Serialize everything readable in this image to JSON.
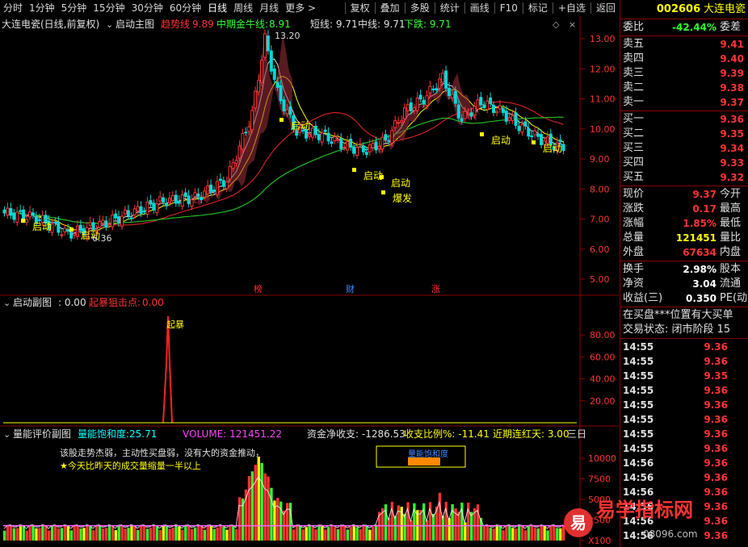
{
  "toolbar": {
    "left": [
      "分时",
      "1分钟",
      "5分钟",
      "15分钟",
      "30分钟",
      "60分钟",
      "日线",
      "周线",
      "月线",
      "更多 >"
    ],
    "right": [
      "复权",
      "叠加",
      "多股",
      "统计",
      "画线",
      "F10",
      "标记",
      "+自选",
      "返回"
    ],
    "active": "日线"
  },
  "main_panel": {
    "title": "大连电瓷(日线,前复权)",
    "indicator": "启动主图",
    "trend_label": "趋势线",
    "trend_value": "9.89",
    "mid_label": "中期金牛线:",
    "mid_value": "8.91",
    "short": "短线: 9.71",
    "mid_line": "中线: 9.71",
    "fall": "下跌: 9.71",
    "y_ticks": [
      "13.00",
      "12.00",
      "11.00",
      "10.00",
      "9.00",
      "8.00",
      "7.00",
      "6.00",
      "5.00"
    ],
    "high_label": "13.20",
    "low_label": "6.36",
    "markers": [
      "启动",
      "启动",
      "启动",
      "启动",
      "启动",
      "爆发",
      "启动",
      "启动"
    ],
    "bottom_marks": [
      "榜",
      "财",
      "涨"
    ]
  },
  "sub_panel": {
    "name": "启动副图",
    "value": ": 0.00",
    "label2": "起暴狙击点:",
    "value2": "0.00",
    "y_ticks": [
      "80.00",
      "60.00",
      "40.00",
      "20.00"
    ],
    "spike_label": "起暴"
  },
  "vol_panel": {
    "name": "量能评价副图",
    "sat_label": "量能饱和度:",
    "sat_value": "25.71",
    "volume": "VOLUME: 121451.22",
    "flow": "资金净收支: -1286.53",
    "ratio": "收支比例%: -11.41",
    "streak": "近期连红天: 3.00",
    "extra": "三日",
    "comment1": "该股走势杰弱，主动性买盘弱，没有大的资金推动，",
    "comment2": "★今天比昨天的成交量缩量一半以上",
    "box_label": "量能饱和度",
    "y_ticks": [
      "10000",
      "7500",
      "5000",
      "2500",
      "X100"
    ]
  },
  "sidebar": {
    "code": "002606",
    "name": "大连电瓷",
    "weibi_label": "委比",
    "weibi_value": "-42.44%",
    "weicha_label": "委差",
    "asks": [
      {
        "label": "卖五",
        "price": "9.41"
      },
      {
        "label": "卖四",
        "price": "9.40"
      },
      {
        "label": "卖三",
        "price": "9.39"
      },
      {
        "label": "卖二",
        "price": "9.38"
      },
      {
        "label": "卖一",
        "price": "9.37"
      }
    ],
    "bids": [
      {
        "label": "买一",
        "price": "9.36"
      },
      {
        "label": "买二",
        "price": "9.35"
      },
      {
        "label": "买三",
        "price": "9.34"
      },
      {
        "label": "买四",
        "price": "9.33"
      },
      {
        "label": "买五",
        "price": "9.32"
      }
    ],
    "stats1": [
      {
        "label": "现价",
        "value": "9.37",
        "cls": "red",
        "label2": "今开"
      },
      {
        "label": "涨跌",
        "value": "0.17",
        "cls": "red",
        "label2": "最高"
      },
      {
        "label": "涨幅",
        "value": "1.85%",
        "cls": "red",
        "label2": "最低"
      },
      {
        "label": "总量",
        "value": "121451",
        "cls": "yel",
        "label2": "量比"
      },
      {
        "label": "外盘",
        "value": "67634",
        "cls": "red",
        "label2": "内盘"
      }
    ],
    "stats2": [
      {
        "label": "换手",
        "value": "2.98%",
        "cls": "wht",
        "label2": "股本"
      },
      {
        "label": "净资",
        "value": "3.04",
        "cls": "wht",
        "label2": "流通"
      },
      {
        "label": "收益(三)",
        "value": "0.350",
        "cls": "wht",
        "label2": "PE(动"
      }
    ],
    "notice": "在买盘***位置有大买单",
    "status": "交易状态: 闭市阶段 15",
    "ticks": [
      {
        "time": "14:55",
        "price": "9.36"
      },
      {
        "time": "14:55",
        "price": "9.36"
      },
      {
        "time": "14:55",
        "price": "9.35"
      },
      {
        "time": "14:55",
        "price": "9.36"
      },
      {
        "time": "14:55",
        "price": "9.36"
      },
      {
        "time": "14:55",
        "price": "9.36"
      },
      {
        "time": "14:55",
        "price": "9.36"
      },
      {
        "time": "14:55",
        "price": "9.36"
      },
      {
        "time": "14:56",
        "price": "9.36"
      },
      {
        "time": "14:56",
        "price": "9.36"
      },
      {
        "time": "14:56",
        "price": "9.36"
      },
      {
        "time": "14:56",
        "price": "9.36"
      },
      {
        "time": "14:56",
        "price": "9.36"
      },
      {
        "time": "14:56",
        "price": "9.36"
      }
    ]
  },
  "watermark": {
    "brand": "易学指标网",
    "glyph": "易",
    "url": "08096.com"
  },
  "colors": {
    "up": "#ff3333",
    "down": "#33ff33",
    "ma_red": "#cc2222",
    "ma_green": "#22bb22",
    "accent": "#ffff00"
  }
}
